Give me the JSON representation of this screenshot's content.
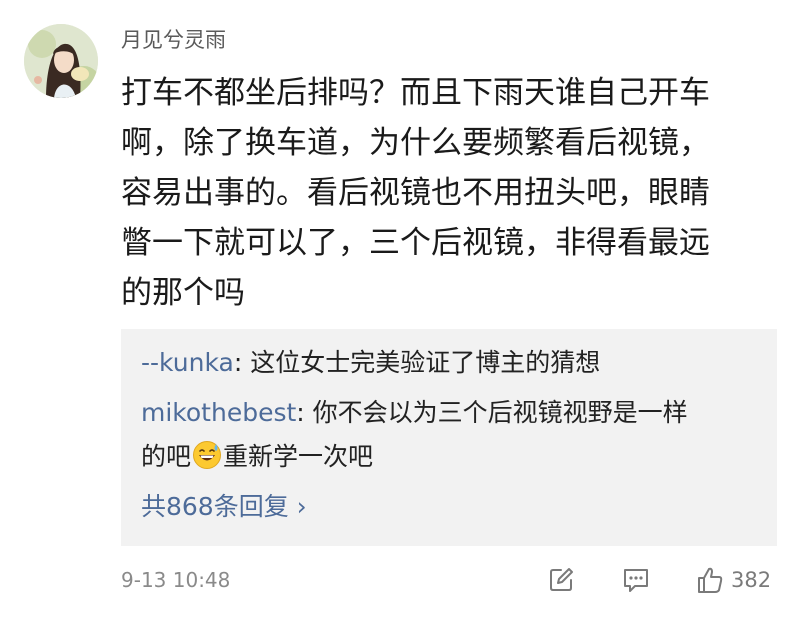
{
  "comment": {
    "author": "月见兮灵雨",
    "body_lines": [
      "打车不都坐后排吗？而且下雨天谁自己开车",
      "啊，除了换车道，为什么要频繁看后视镜，",
      "容易出事的。看后视镜也不用扭头吧，眼睛",
      "瞥一下就可以了，三个后视镜，非得看最远",
      "的那个吗"
    ],
    "timestamp": "9-13 10:48",
    "like_count": "382"
  },
  "replies": [
    {
      "user": "--kunka",
      "separator": ": ",
      "text": "这位女士完美验证了博主的猜想"
    },
    {
      "user": "mikothebest",
      "separator": ": ",
      "text_line1": "你不会以为三个后视镜视野是一样",
      "text_line2_before": "的吧",
      "emoji_icon": "grinning-sweat-emoji-icon",
      "text_line2_after": "重新学一次吧"
    }
  ],
  "more_replies": "共868条回复 ›",
  "icons": {
    "edit": "edit-icon",
    "comment": "comment-icon",
    "like": "thumbs-up-icon"
  },
  "colors": {
    "reply_user": "#4d6b99",
    "reply_bg": "#f2f2f2",
    "meta": "#8a8a8a"
  }
}
